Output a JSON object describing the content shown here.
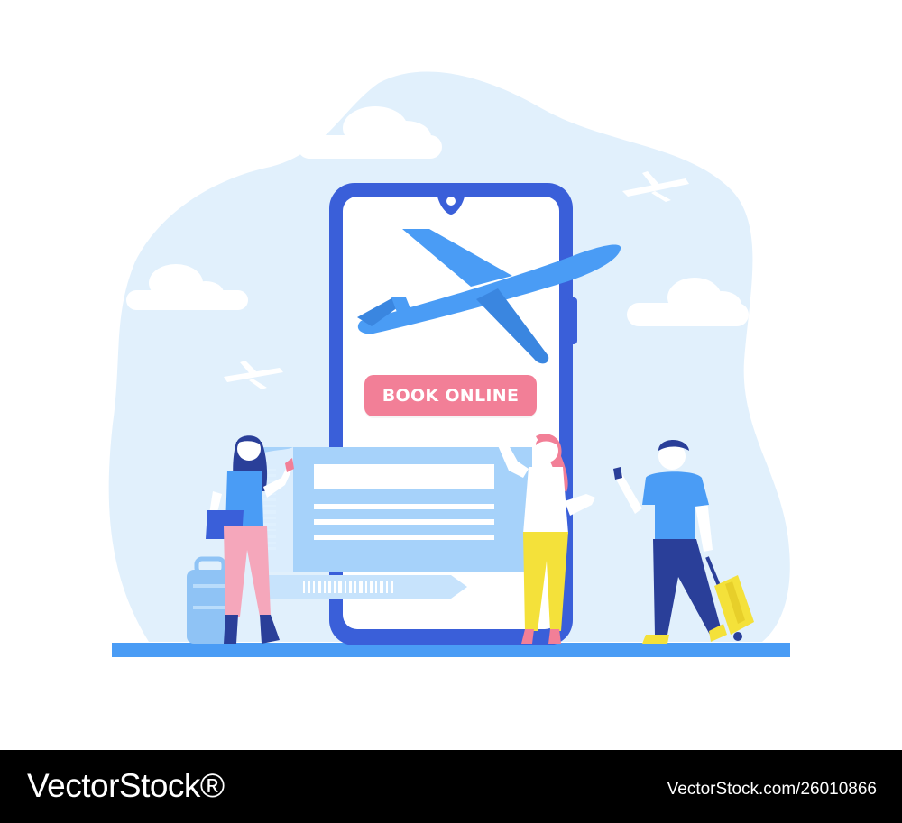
{
  "colors": {
    "sky": "#e1f0fc",
    "phone_frame": "#3a5fd9",
    "airplane": "#4a9cf5",
    "book_button": "#f27f97",
    "ticket": "#a6d2fa",
    "ground": "#4a9cf5",
    "footer_bg": "#000000"
  },
  "phone": {
    "book_button_label": "BOOK ONLINE"
  },
  "icons": [
    "airplane-icon",
    "small-airplane-icon",
    "cloud-icon",
    "suitcase-icon",
    "barcode-icon"
  ],
  "footer": {
    "brand": "VectorStock®",
    "image_id": "VectorStock.com/26010866"
  }
}
